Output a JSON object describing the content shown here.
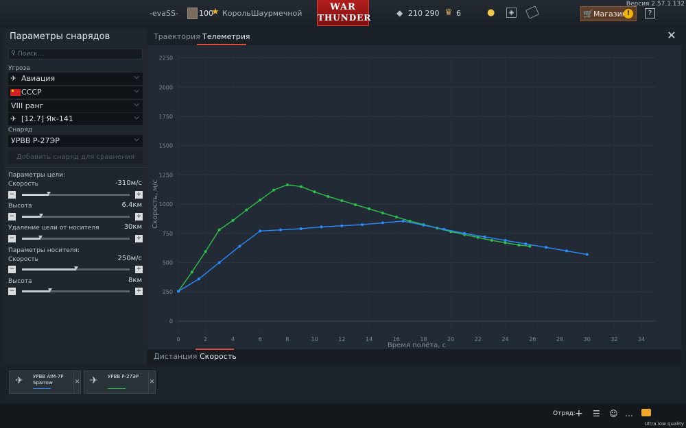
{
  "top": {
    "nickname": "-evaSS-",
    "level": "100",
    "title": "КорольШаурмечной",
    "logo_line1": "WAR",
    "logo_line2": "THUNDER",
    "silver": "210 290",
    "gold": "6",
    "shop_label": "Магазин",
    "shop_alert": "!",
    "help": "?",
    "version": "Версия 2.57.1.132"
  },
  "left": {
    "title": "Параметры снарядов",
    "search_placeholder": "Поиск...",
    "threat_label": "Угроза",
    "threat_type": "Авиация",
    "country": "СССР",
    "rank": "VIII ранг",
    "aircraft": "[12.7] Як-141",
    "shell_label": "Снаряд",
    "shell": "УРВВ Р-27ЭР",
    "add_compare": "Добавить снаряд для сравнения",
    "target_params": "Параметры цели:",
    "carrier_params": "Параметры носителя:",
    "sliders": [
      {
        "label": "Скорость",
        "value": "-310м/с",
        "level": 0.25
      },
      {
        "label": "Высота",
        "value": "6.4км",
        "level": 0.18
      },
      {
        "label": "Удаление цели от носителя",
        "value": "30км",
        "level": 0.17
      },
      {
        "label": "Скорость",
        "value": "250м/с",
        "level": 0.5
      },
      {
        "label": "Высота",
        "value": "8км",
        "level": 0.26
      }
    ]
  },
  "tabs": {
    "top": [
      "Траектория",
      "Телеметрия"
    ],
    "bottom": [
      "Дистанция",
      "Скорость"
    ]
  },
  "colors": {
    "green": "#2fc24a",
    "blue": "#2a8cff",
    "accent": "#e04b3a"
  },
  "chart_data": {
    "type": "line",
    "xlabel": "Время полёта, с",
    "ylabel": "Скорость, м/с",
    "xlim": [
      0,
      35
    ],
    "ylim": [
      -100,
      2300
    ],
    "xticks": [
      0,
      2,
      4,
      6,
      8,
      10,
      12,
      14,
      16,
      18,
      20,
      22,
      24,
      26,
      28,
      30,
      32,
      34
    ],
    "yticks": [
      0,
      250,
      500,
      750,
      1000,
      1250,
      1500,
      1750,
      2000,
      2250
    ],
    "grid": true,
    "series": [
      {
        "name": "УРВВ Р-27ЭР",
        "color": "#2fc24a",
        "x": [
          0,
          1,
          2,
          3,
          4,
          5,
          6,
          7,
          8,
          9,
          10,
          11,
          12,
          13,
          14,
          15,
          16,
          17,
          18,
          19,
          20,
          21,
          22,
          23,
          24,
          25,
          25.8
        ],
        "y": [
          255,
          420,
          595,
          780,
          860,
          950,
          1035,
          1120,
          1165,
          1150,
          1105,
          1065,
          1030,
          995,
          960,
          925,
          890,
          855,
          825,
          795,
          765,
          740,
          715,
          690,
          670,
          650,
          640
        ]
      },
      {
        "name": "УРВВ AIM-7P Sparrow",
        "color": "#2a8cff",
        "x": [
          0,
          1.5,
          3,
          4.5,
          6,
          7.5,
          9,
          10.5,
          12,
          13.5,
          15,
          16.5,
          18,
          19.5,
          21,
          22.5,
          24,
          25.5,
          27,
          28.5,
          30
        ],
        "y": [
          255,
          360,
          500,
          640,
          770,
          780,
          790,
          805,
          815,
          825,
          840,
          855,
          820,
          785,
          750,
          720,
          690,
          660,
          630,
          600,
          570
        ]
      }
    ]
  },
  "compare": [
    {
      "name": "УРВВ AIM-7P Sparrow",
      "color": "#2a8cff"
    },
    {
      "name": "УРВВ Р-27ЭР",
      "color": "#2fc24a"
    }
  ],
  "bottom": {
    "squad": "Отряд:",
    "quality": "Ultra low quality"
  }
}
